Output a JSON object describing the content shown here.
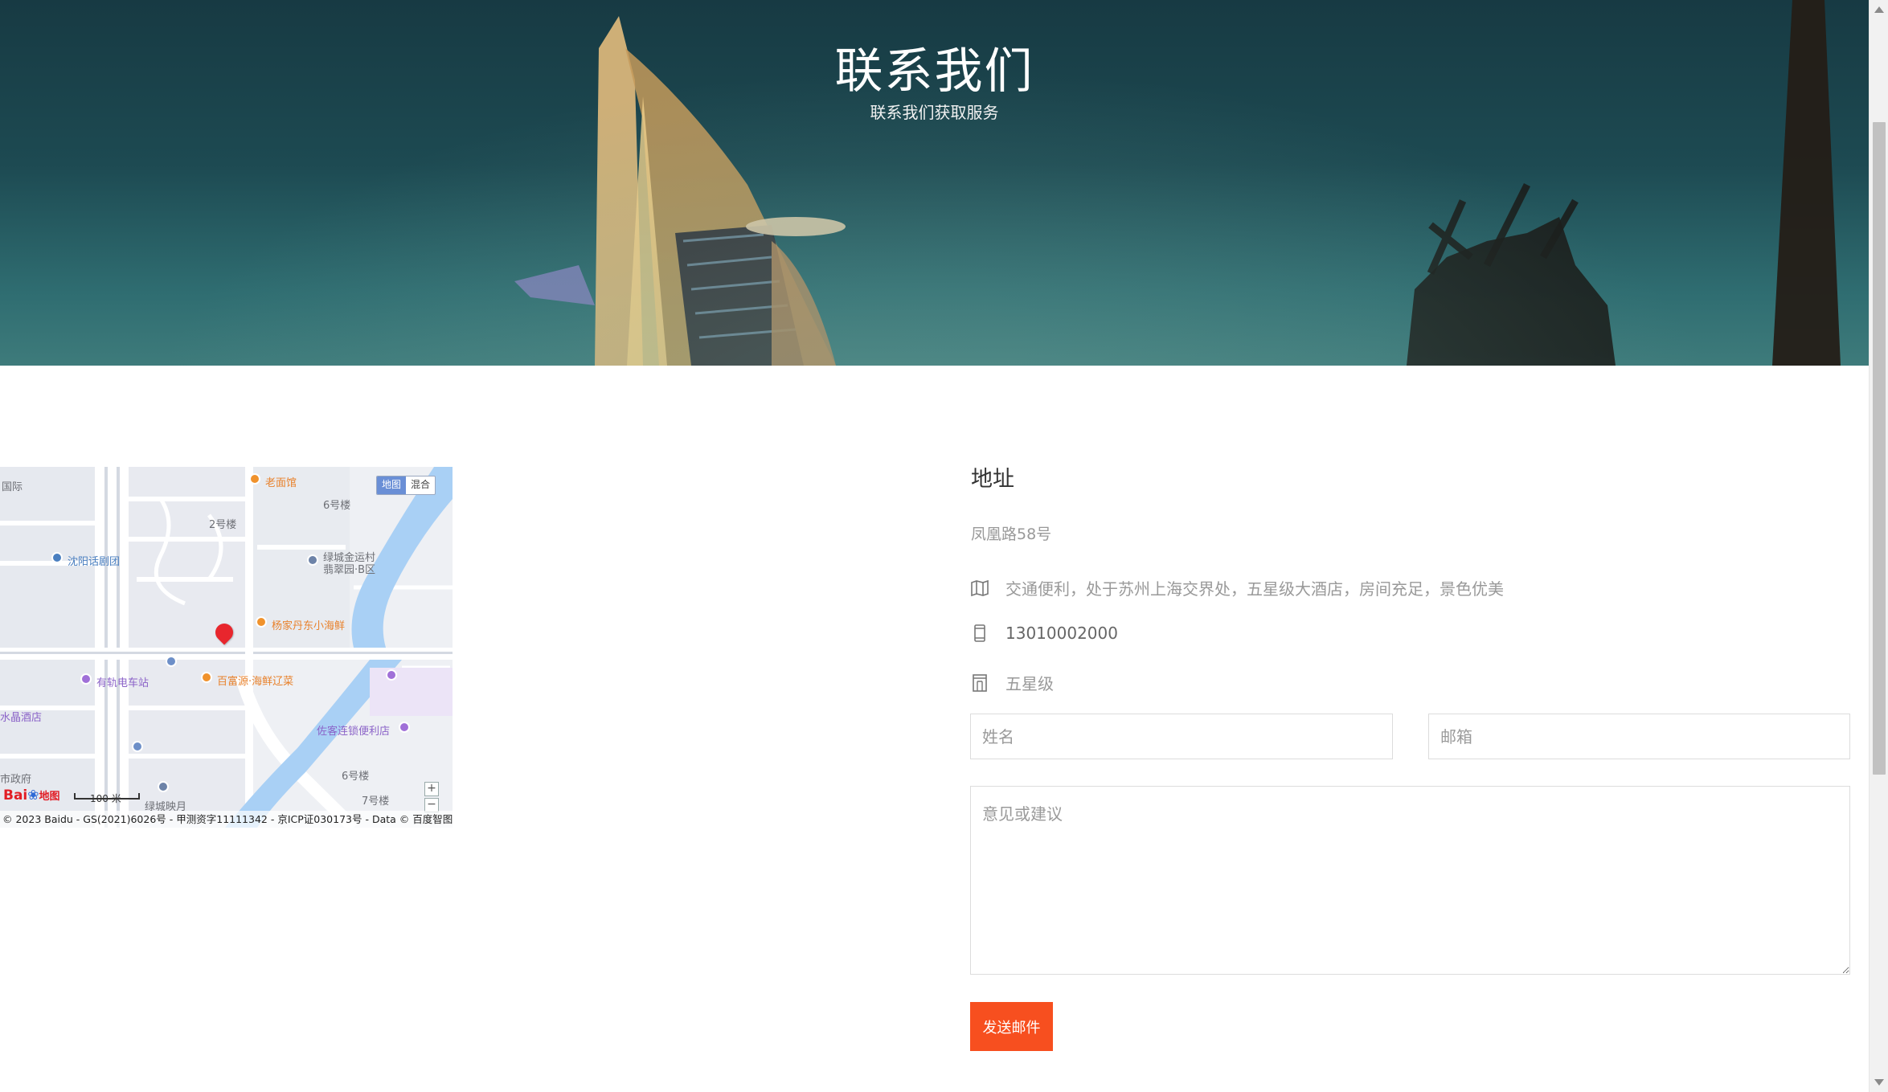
{
  "hero": {
    "title": "联系我们",
    "subtitle": "联系我们获取服务"
  },
  "map": {
    "type_switch": [
      "地图",
      "混合"
    ],
    "labels": [
      {
        "text": "国际",
        "cls": ""
      },
      {
        "text": "老面馆",
        "cls": "poi-orange"
      },
      {
        "text": "6号楼",
        "cls": ""
      },
      {
        "text": "2号楼",
        "cls": ""
      },
      {
        "text": "沈阳话剧团",
        "cls": "poi-blue"
      },
      {
        "text": "绿城金运村",
        "cls": ""
      },
      {
        "text": "翡翠园·B区",
        "cls": ""
      },
      {
        "text": "杨家丹东小海鲜",
        "cls": "poi-orange"
      },
      {
        "text": "有轨电车站",
        "cls": "poi-purple"
      },
      {
        "text": "百富源·海鲜辽菜",
        "cls": "poi-orange"
      },
      {
        "text": "水晶酒店",
        "cls": "poi-purple"
      },
      {
        "text": "佐客连锁便利店",
        "cls": "poi-purple"
      },
      {
        "text": "市政府",
        "cls": ""
      },
      {
        "text": "6号楼",
        "cls": ""
      },
      {
        "text": "绿城映月",
        "cls": ""
      },
      {
        "text": "7号楼",
        "cls": ""
      }
    ],
    "scale": "100 米",
    "logo": "Bai",
    "logo_suffix": "地图",
    "zoom_in": "+",
    "zoom_out": "−",
    "copyright": "© 2023 Baidu - GS(2021)6026号 - 甲测资字11111342 - 京ICP证030173号 - Data © 百度智图"
  },
  "contact": {
    "title": "地址",
    "address": "凤凰路58号",
    "description": "交通便利，处于苏州上海交界处，五星级大酒店，房间充足，景色优美",
    "phone": "13010002000",
    "rating": "五星级"
  },
  "form": {
    "name_placeholder": "姓名",
    "email_placeholder": "邮箱",
    "message_placeholder": "意见或建议",
    "submit_label": "发送邮件"
  },
  "colors": {
    "accent": "#f74f1f",
    "hero_bg": "#1d4a52"
  }
}
